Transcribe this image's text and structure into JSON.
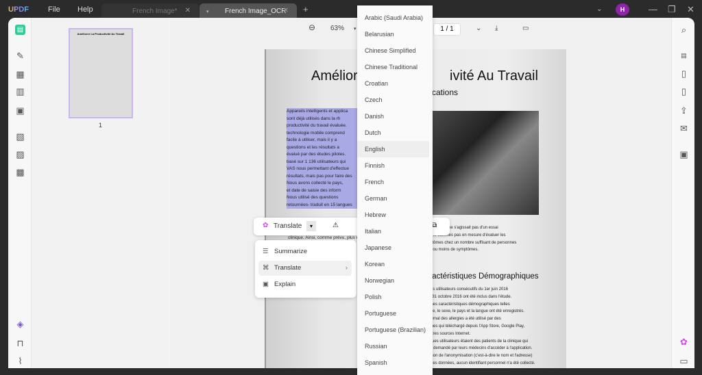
{
  "app": {
    "logo": "UPDF",
    "menu": [
      "File",
      "Help"
    ],
    "avatar": "H"
  },
  "tabs": [
    {
      "label": "French Image*",
      "active": false
    },
    {
      "label": "French Image_OCR",
      "active": true
    }
  ],
  "toolbar": {
    "zoom": "63%",
    "page": "1 / 1"
  },
  "thumbnail": {
    "page_number": "1",
    "title": "Améliorer La Productivité Au Travail"
  },
  "document": {
    "title": "Améliorer La Productivité Au Travail",
    "title_visible_left": "Amélior",
    "title_visible_right": "ivité Au Travail",
    "subtitle": "plications",
    "selected_text": [
      "Appareils intelligents et applica",
      "sont déjà utilisés dans la rh",
      "productivité du travail évaluée.",
      "technologie mobile comprend",
      "facile à utiliser, mais il y a",
      "questions et les résultats a",
      "évalué par des études pilotes.",
      "basé sur 1 136 utilisateurs qui",
      "VAS nous permettant d'effectue",
      "résultats, mais pas pour faire des",
      "Nous avons collecté le pays,",
      "et date de saisie des inform",
      "Nous utilisé des questions",
      "retournées- traduit en 15 langues"
    ],
    "para1": [
      "émoins et il ne s'agissait pas d'un essai",
      "us ne sommes pas en mesure d'évaluer les",
      "mptômes chez un nombre suffisant de personnes",
      "lus ou moins de symptômes."
    ],
    "heading2": "aractéristiques Démographiques",
    "para2": [
      "s les utilisateurs consécutifs du 1er juin 2016",
      "Le 31 octobre 2016 ont été inclus dans l'étude.",
      "taines caractéristiques démographiques telles",
      "l'âge, le sexe, le pays et la langue ont été enregistrés.",
      "Journal des allergies a été utilisé par des",
      "onnes qui téléchargé depuis l'App Store, Google Play,",
      "'autres sources Internet.",
      "elques utilisateurs étaient des patients de la clinique qui",
      "ent demandé par leurs médecins d'accéder à l'application.",
      "raison de l'anonymisation (c'est-à-dire le nom et l'adresse)",
      "mi les données, aucun identifiant personnel n'a été collecté."
    ],
    "left_fragment": "clinique. Ainsi, comme prévu, plus de"
  },
  "floatbar": {
    "translate_label": "Translate"
  },
  "context_menu": [
    {
      "label": "Summarize",
      "icon": "list-icon"
    },
    {
      "label": "Translate",
      "icon": "translate-icon",
      "active": true
    },
    {
      "label": "Explain",
      "icon": "explain-icon"
    }
  ],
  "languages": {
    "items": [
      "Arabic (Saudi Arabia)",
      "Belarusian",
      "Chinese Simplified",
      "Chinese Traditional",
      "Croatian",
      "Czech",
      "Danish",
      "Dutch",
      "English",
      "Finnish",
      "French",
      "German",
      "Hebrew",
      "Italian",
      "Japanese",
      "Korean",
      "Norwegian",
      "Polish",
      "Portuguese",
      "Portuguese (Brazilian)",
      "Russian",
      "Spanish"
    ],
    "highlighted": "English"
  },
  "colors": {
    "accent": "#8e24aa",
    "selection": "#a9a9e6",
    "titlebar": "#2b2b2b"
  }
}
